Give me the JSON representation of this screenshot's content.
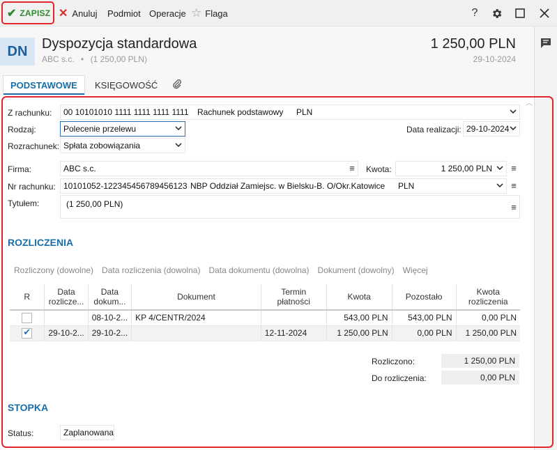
{
  "toolbar": {
    "save": "ZAPISZ",
    "cancel": "Anuluj",
    "subject": "Podmiot",
    "operations": "Operacje",
    "flag": "Flaga",
    "help": "?",
    "icons": [
      "check-icon",
      "close-red-icon",
      "star-icon",
      "help-icon",
      "gear-icon",
      "maximize-icon",
      "close-icon"
    ]
  },
  "header": {
    "badge": "DN",
    "title": "Dyspozycja standardowa",
    "subtitle_company": "ABC s.c.",
    "subtitle_sep": "•",
    "subtitle_amount": "(1 250,00 PLN)",
    "amount": "1 250,00 PLN",
    "date": "29-10-2024"
  },
  "tabs": {
    "basic": "PODSTAWOWE",
    "accounting": "KSIĘGOWOŚĆ"
  },
  "form": {
    "from_account_label": "Z rachunku:",
    "from_account_number": "00 10101010 1111 1111 1111 1111",
    "from_account_name": "Rachunek podstawowy",
    "from_account_currency": "PLN",
    "type_label": "Rodzaj:",
    "type_value": "Polecenie przelewu",
    "exec_date_label": "Data realizacji:",
    "exec_date_value": "29-10-2024",
    "settlement_label": "Rozrachunek:",
    "settlement_value": "Spłata zobowiązania",
    "company_label": "Firma:",
    "company_value": "ABC s.c.",
    "amount_label": "Kwota:",
    "amount_value": "1 250,00 PLN",
    "account_no_label": "Nr rachunku:",
    "account_no_value": "10101052-122345456789456123",
    "bank_name": "NBP Oddział Zamiejsc. w Bielsku-B.  O/Okr.Katowice",
    "account_currency": "PLN",
    "title_label": "Tytułem:",
    "title_value": "(1 250,00 PLN)"
  },
  "settlements": {
    "section_title": "ROZLICZENIA",
    "filters": [
      "Rozliczony (dowolne)",
      "Data rozliczenia (dowolna)",
      "Data dokumentu (dowolna)",
      "Dokument (dowolny)",
      "Więcej"
    ],
    "columns": [
      {
        "l1": "R",
        "l2": ""
      },
      {
        "l1": "Data",
        "l2": "rozlicze..."
      },
      {
        "l1": "Data",
        "l2": "dokum..."
      },
      {
        "l1": "Dokument",
        "l2": ""
      },
      {
        "l1": "Termin",
        "l2": "płatności"
      },
      {
        "l1": "Kwota",
        "l2": ""
      },
      {
        "l1": "Pozostało",
        "l2": ""
      },
      {
        "l1": "Kwota",
        "l2": "rozliczenia"
      }
    ],
    "rows": [
      {
        "checked": false,
        "settle_date": "",
        "doc_date": "08-10-2...",
        "document": "KP 4/CENTR/2024",
        "due": "",
        "amount": "543,00 PLN",
        "remaining": "543,00 PLN",
        "settled": "0,00 PLN"
      },
      {
        "checked": true,
        "settle_date": "29-10-2...",
        "doc_date": "29-10-2...",
        "document": "",
        "due": "12-11-2024",
        "amount": "1 250,00 PLN",
        "remaining": "0,00 PLN",
        "settled": "1 250,00 PLN"
      }
    ],
    "settled_label": "Rozliczono:",
    "settled_value": "1 250,00 PLN",
    "to_settle_label": "Do rozliczenia:",
    "to_settle_value": "0,00 PLN"
  },
  "footer": {
    "section_title": "STOPKA",
    "status_label": "Status:",
    "status_value": "Zaplanowana"
  }
}
